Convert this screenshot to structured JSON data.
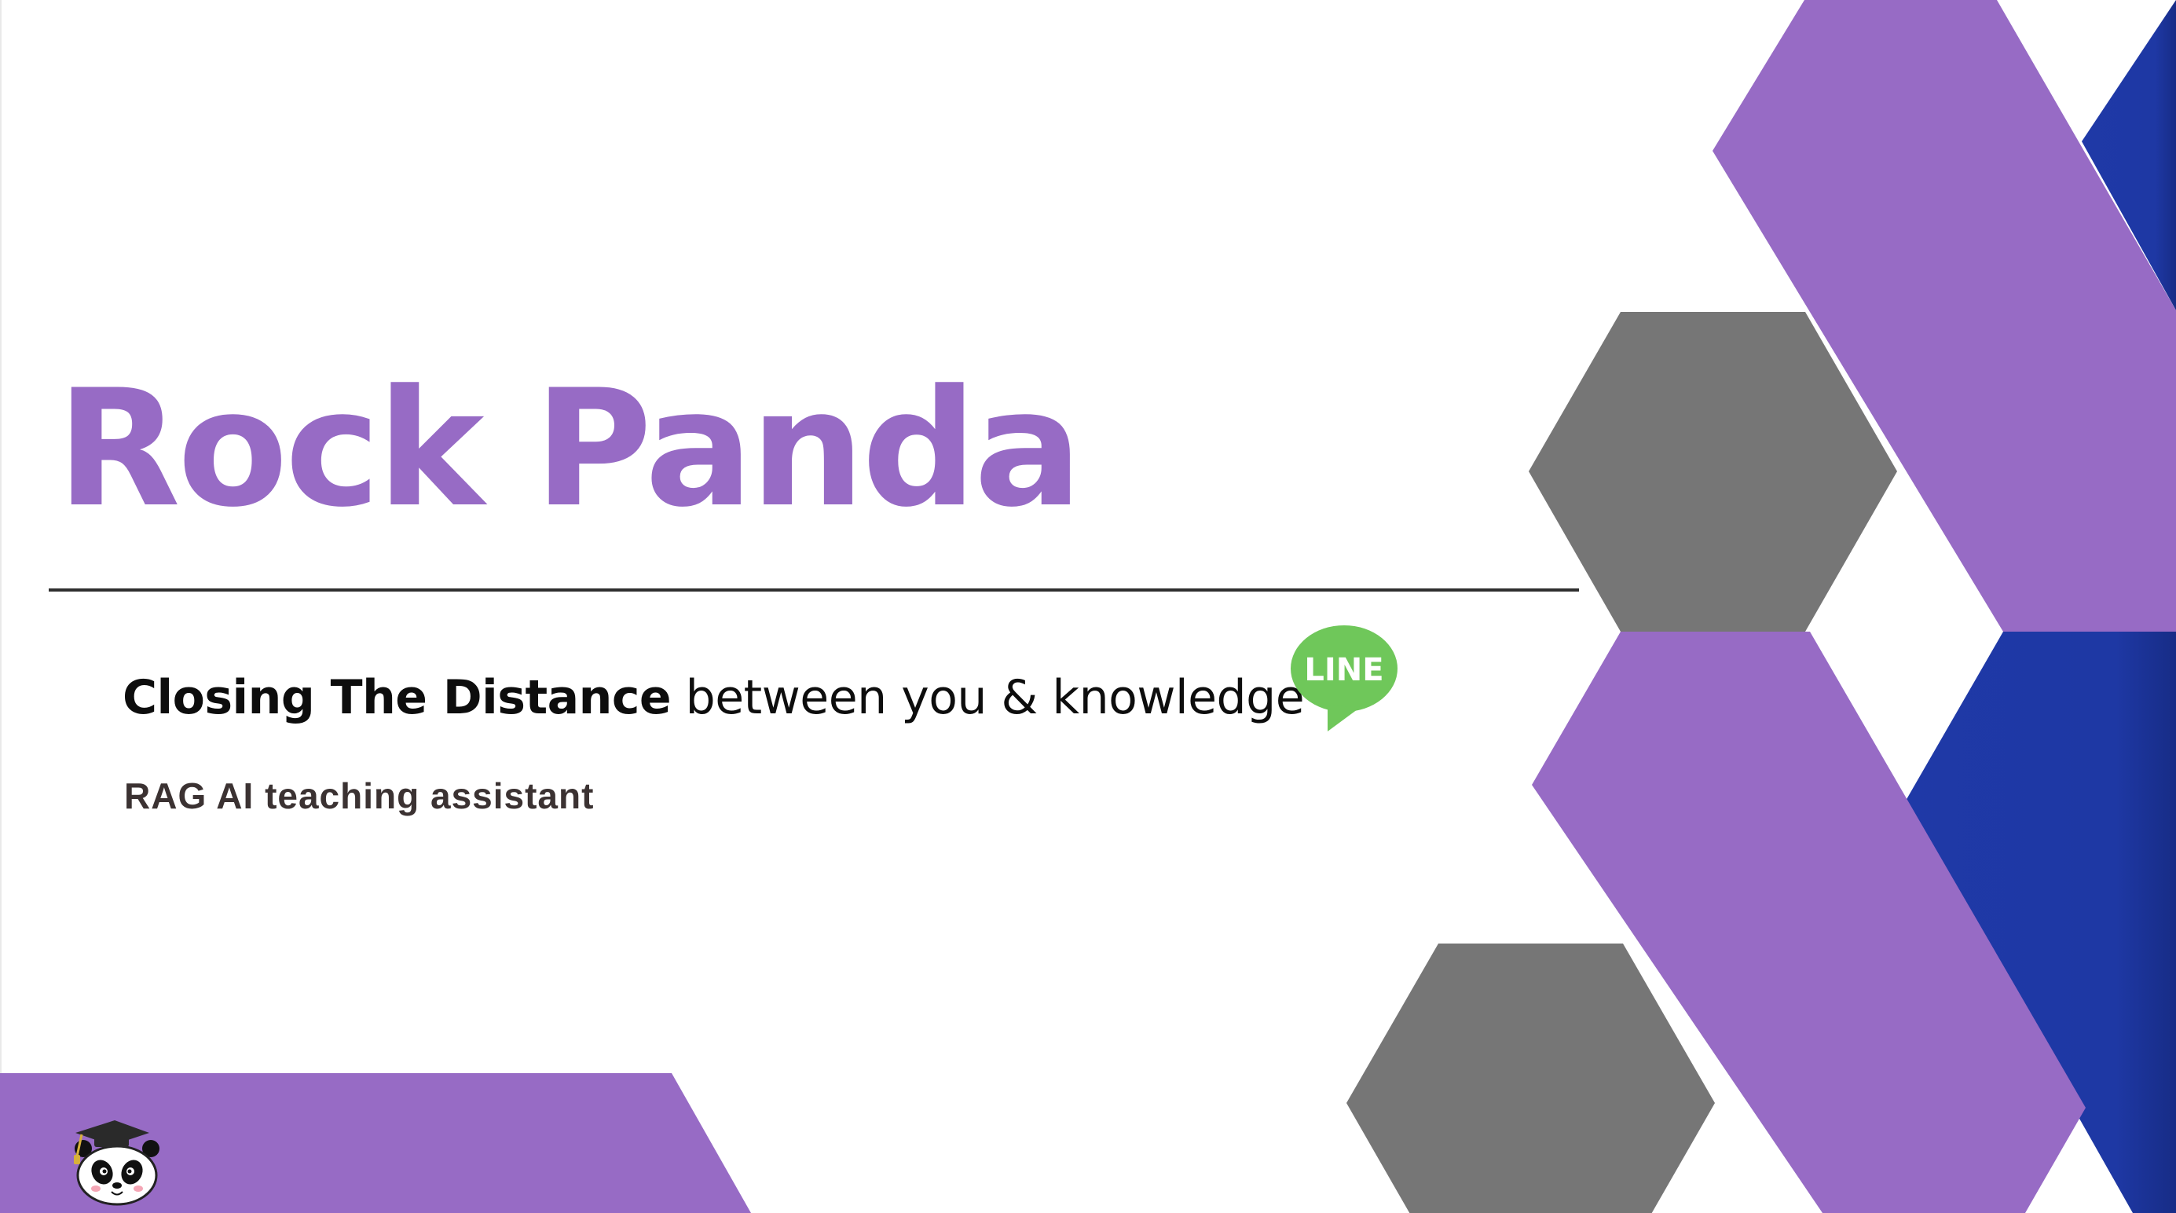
{
  "slide": {
    "title": "Rock Panda",
    "tagline_bold": "Closing The Distance",
    "tagline_rest": " between you & knowledge",
    "subtitle": "RAG AI teaching assistant",
    "line_badge": "LINE"
  },
  "colors": {
    "purple": "#976bc5",
    "gray": "#767676",
    "blue": "#1f39a7",
    "line_green": "#6fc75a"
  },
  "icons": {
    "line": "line-chat-bubble-icon",
    "mascot": "panda-graduate-icon"
  }
}
